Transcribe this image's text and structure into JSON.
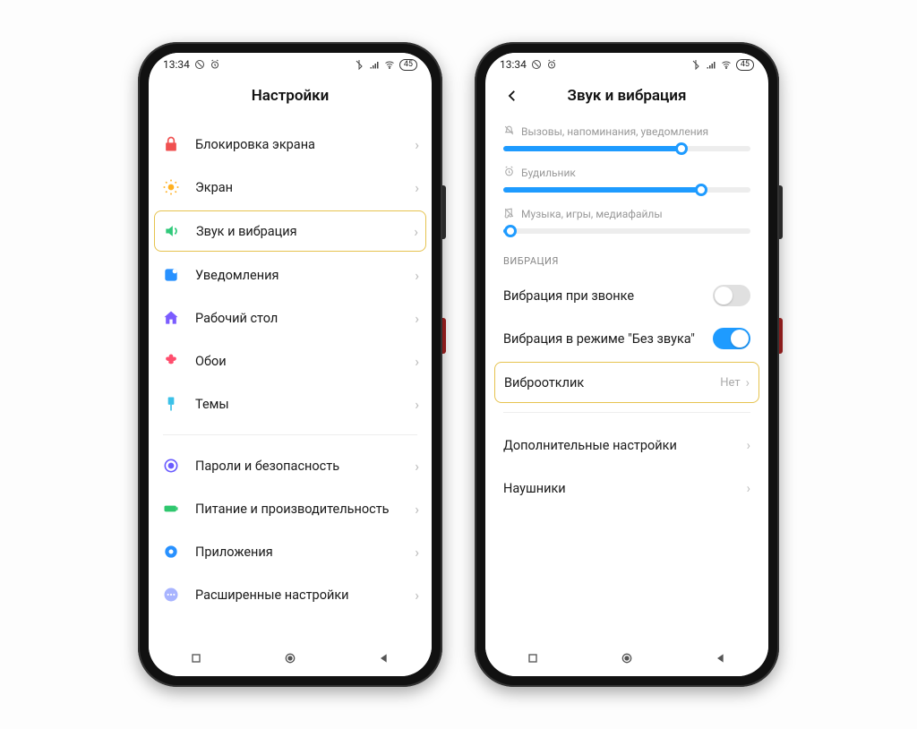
{
  "status": {
    "time": "13:34",
    "battery": "45"
  },
  "left": {
    "title": "Настройки",
    "items": [
      {
        "label": "Блокировка экрана",
        "icon": "lock"
      },
      {
        "label": "Экран",
        "icon": "sun"
      },
      {
        "label": "Звук и вибрация",
        "icon": "volume",
        "highlight": true
      },
      {
        "label": "Уведомления",
        "icon": "notif"
      },
      {
        "label": "Рабочий стол",
        "icon": "home"
      },
      {
        "label": "Обои",
        "icon": "flower"
      },
      {
        "label": "Темы",
        "icon": "brush"
      }
    ],
    "items2": [
      {
        "label": "Пароли и безопасность",
        "icon": "shield"
      },
      {
        "label": "Питание и производительность",
        "icon": "battery"
      },
      {
        "label": "Приложения",
        "icon": "apps"
      },
      {
        "label": "Расширенные настройки",
        "icon": "more"
      }
    ]
  },
  "right": {
    "title": "Звук и вибрация",
    "sliders": [
      {
        "label": "Вызовы, напоминания, уведомления",
        "icon": "bell-slash",
        "value": 72
      },
      {
        "label": "Будильник",
        "icon": "alarm",
        "value": 80
      },
      {
        "label": "Музыка, игры, медиафайлы",
        "icon": "note-slash",
        "value": 3
      }
    ],
    "section": "ВИБРАЦИЯ",
    "vibrate_call": {
      "label": "Вибрация при звонке",
      "on": false
    },
    "vibrate_silent": {
      "label": "Вибрация в режиме \"Без звука\"",
      "on": true
    },
    "haptic": {
      "label": "Виброотклик",
      "value": "Нет"
    },
    "more1": "Дополнительные настройки",
    "more2": "Наушники"
  }
}
